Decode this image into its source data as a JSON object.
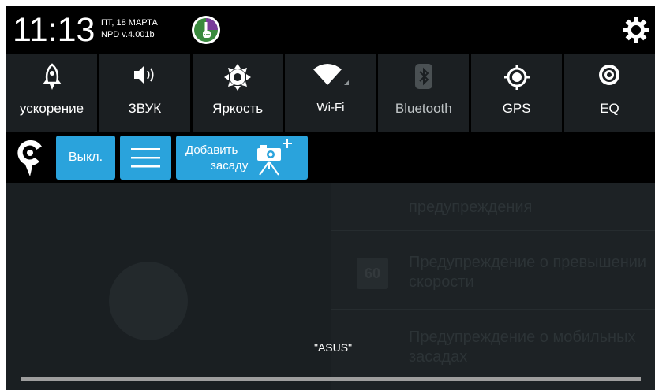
{
  "status_bar": {
    "time": "11:13",
    "date": "ПТ, 18 МАРТА",
    "version": "NPD v.4.001b",
    "carrier_icon": "megafon-icon",
    "settings_icon": "gear-icon"
  },
  "quick_settings": [
    {
      "label": "ускорение",
      "icon": "rocket-icon"
    },
    {
      "label": "ЗВУК",
      "icon": "speaker-icon"
    },
    {
      "label": "Яркость",
      "icon": "brightness-icon"
    },
    {
      "label": "Wi-Fi",
      "icon": "wifi-icon"
    },
    {
      "label": "Bluetooth",
      "icon": "bluetooth-icon"
    },
    {
      "label": "GPS",
      "icon": "gps-icon"
    },
    {
      "label": "EQ",
      "icon": "equalizer-icon"
    }
  ],
  "action_bar": {
    "off_label": "Выкл.",
    "add_line1": "Добавить",
    "add_line2": "засаду"
  },
  "background": {
    "item1": "предупреждения",
    "item2_line1": "Предупреждение о превышении",
    "item2_line2": "скорости",
    "item2_badge": "60",
    "item3_line1": "Предупреждение о мобильных",
    "item3_line2": "засадах"
  },
  "toast": "\"ASUS\"",
  "progress": 1.0,
  "colors": {
    "accent": "#2aa3dc",
    "tile_bg": "#1b1f22"
  }
}
